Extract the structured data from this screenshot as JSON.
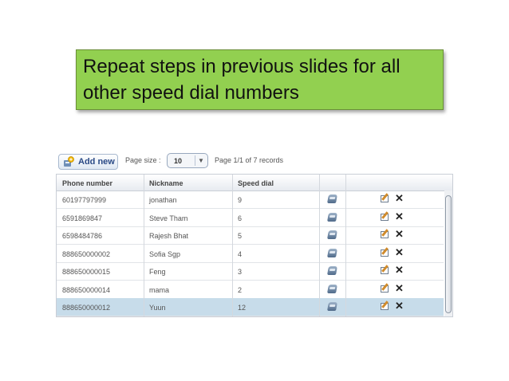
{
  "callout": {
    "line1": "Repeat steps in previous slides for all",
    "line2": "other speed dial numbers"
  },
  "toolbar": {
    "add_label": "Add new",
    "page_size_label": "Page size :",
    "page_size_value": "10",
    "records_text": "Page 1/1 of 7 records"
  },
  "table": {
    "headers": [
      "Phone number",
      "Nickname",
      "Speed dial"
    ],
    "rows": [
      {
        "phone": "60197797999",
        "nickname": "jonathan",
        "speed_dial": "9"
      },
      {
        "phone": "6591869847",
        "nickname": "Steve Tham",
        "speed_dial": "6"
      },
      {
        "phone": "6598484786",
        "nickname": "Rajesh Bhat",
        "speed_dial": "5"
      },
      {
        "phone": "888650000002",
        "nickname": "Sofia Sgp",
        "speed_dial": "4"
      },
      {
        "phone": "888650000015",
        "nickname": "Feng",
        "speed_dial": "3"
      },
      {
        "phone": "888650000014",
        "nickname": "mama",
        "speed_dial": "2"
      },
      {
        "phone": "888650000012",
        "nickname": "Yuun",
        "speed_dial": "12"
      }
    ],
    "selected_row": 6,
    "row_icons": [
      "phone-icon",
      "edit-icon",
      "delete-icon"
    ]
  },
  "colors": {
    "callout_bg": "#92d050",
    "selected_row": "#c7dcea"
  }
}
